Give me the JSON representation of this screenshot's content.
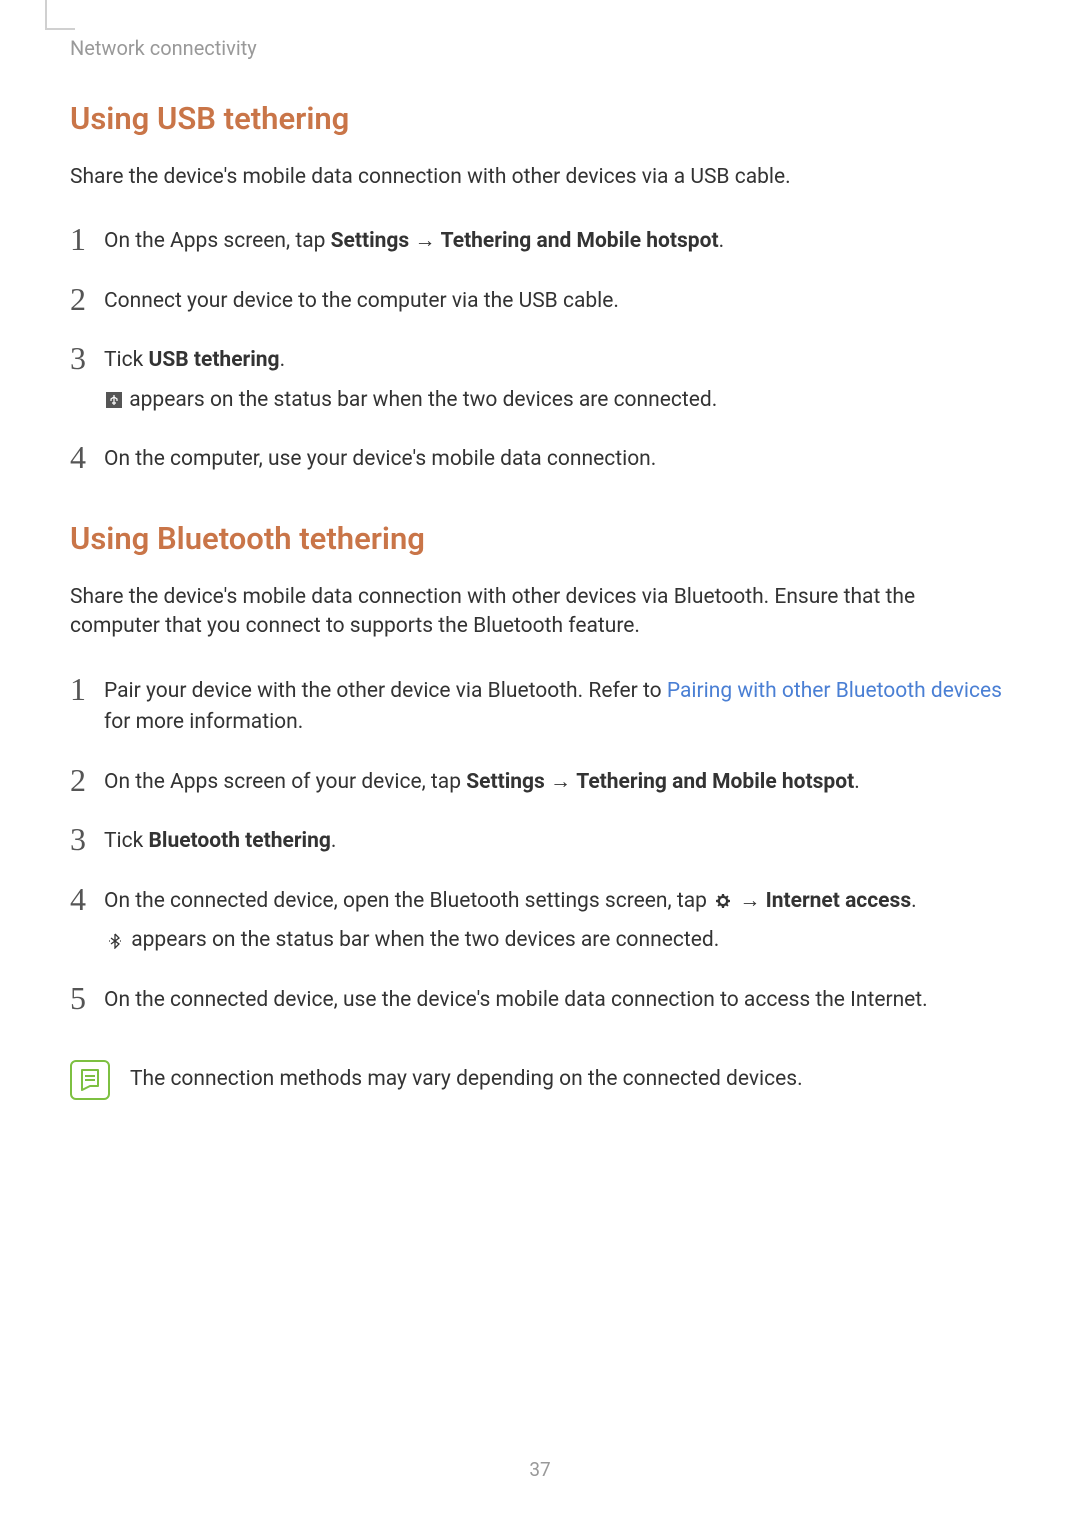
{
  "breadcrumb": "Network connectivity",
  "sections": {
    "usb": {
      "heading": "Using USB tethering",
      "intro": "Share the device's mobile data connection with other devices via a USB cable.",
      "steps": {
        "s1_prefix": "On the Apps screen, tap ",
        "s1_bold1": "Settings",
        "s1_arrow": " → ",
        "s1_bold2": "Tethering and Mobile hotspot",
        "s1_suffix": ".",
        "s2": "Connect your device to the computer via the USB cable.",
        "s3_prefix": "Tick ",
        "s3_bold": "USB tethering",
        "s3_suffix": ".",
        "s3_sub": " appears on the status bar when the two devices are connected.",
        "s4": "On the computer, use your device's mobile data connection."
      }
    },
    "bt": {
      "heading": "Using Bluetooth tethering",
      "intro": "Share the device's mobile data connection with other devices via Bluetooth. Ensure that the computer that you connect to supports the Bluetooth feature.",
      "steps": {
        "s1_prefix": "Pair your device with the other device via Bluetooth. Refer to ",
        "s1_link": "Pairing with other Bluetooth devices",
        "s1_suffix": " for more information.",
        "s2_prefix": "On the Apps screen of your device, tap ",
        "s2_bold1": "Settings",
        "s2_arrow": " → ",
        "s2_bold2": "Tethering and Mobile hotspot",
        "s2_suffix": ".",
        "s3_prefix": "Tick ",
        "s3_bold": "Bluetooth tethering",
        "s3_suffix": ".",
        "s4_prefix": "On the connected device, open the Bluetooth settings screen, tap ",
        "s4_arrow": " → ",
        "s4_bold": "Internet access",
        "s4_suffix": ".",
        "s4_sub": " appears on the status bar when the two devices are connected.",
        "s5": "On the connected device, use the device's mobile data connection to access the Internet."
      },
      "note": "The connection methods may vary depending on the connected devices."
    }
  },
  "numbers": {
    "n1": "1",
    "n2": "2",
    "n3": "3",
    "n4": "4",
    "n5": "5"
  },
  "page_number": "37"
}
